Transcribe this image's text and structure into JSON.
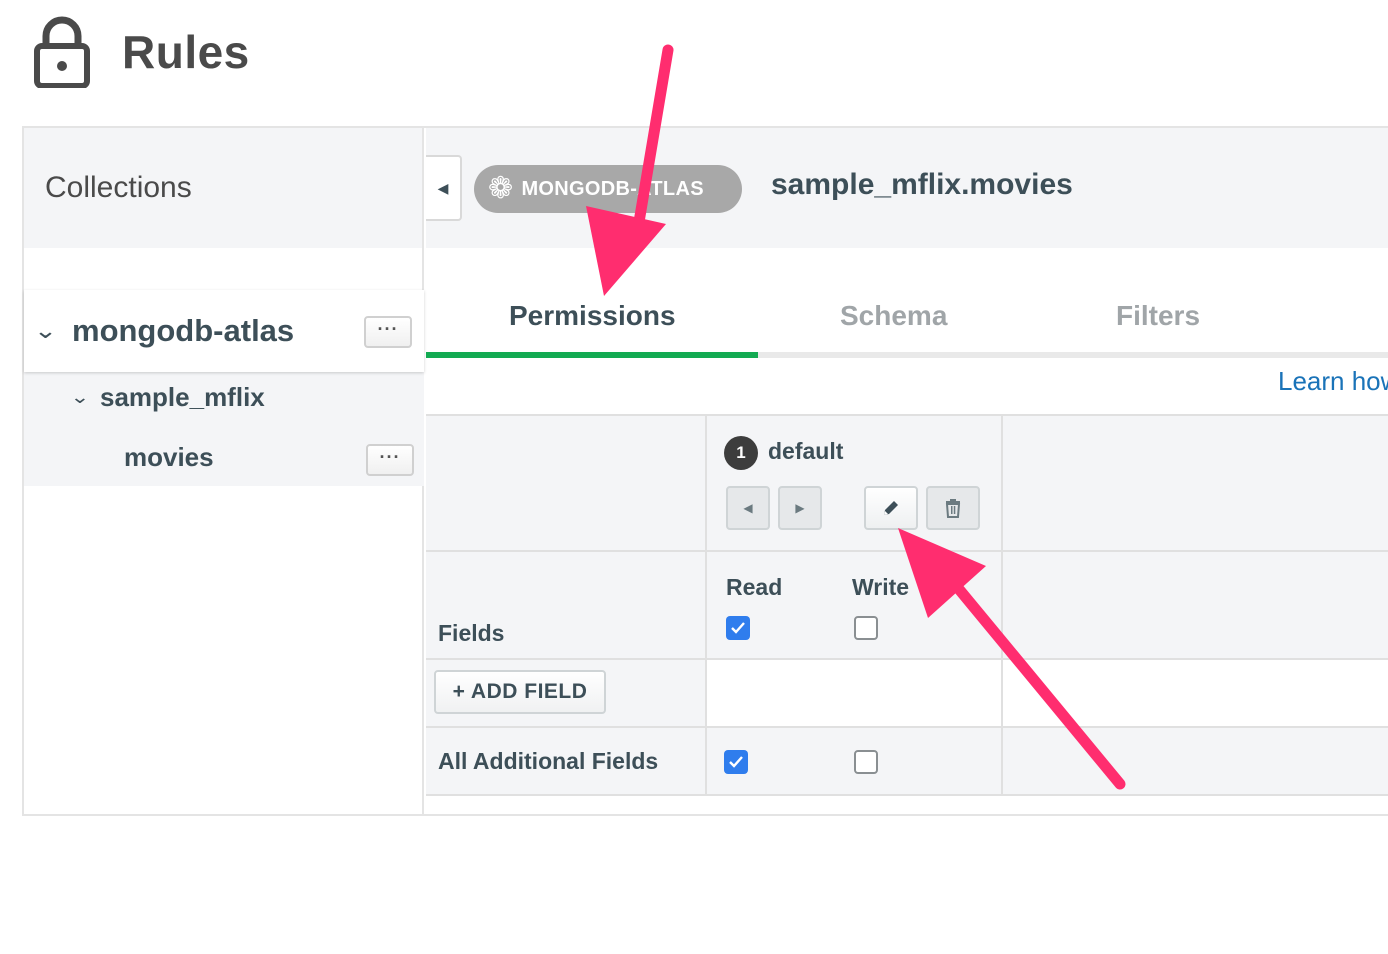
{
  "page": {
    "title": "Rules",
    "icon": "lock-icon"
  },
  "sidebar": {
    "heading": "Collections",
    "database": {
      "label": "mongodb-atlas",
      "menu_label": "···"
    },
    "collection_group": {
      "label": "sample_mflix"
    },
    "collection": {
      "label": "movies",
      "menu_label": "···"
    }
  },
  "main": {
    "service_badge": "MONGODB-ATLAS",
    "namespace": "sample_mflix.movies",
    "tabs": [
      {
        "label": "Permissions",
        "active": true
      },
      {
        "label": "Schema",
        "active": false
      },
      {
        "label": "Filters",
        "active": false
      }
    ],
    "learn_link": "Learn how"
  },
  "roles": {
    "index": "1",
    "name": "default"
  },
  "permissions": {
    "read_label": "Read",
    "write_label": "Write",
    "fields_label": "Fields",
    "fields_read": true,
    "fields_write": false,
    "add_field_label": "+ ADD FIELD",
    "additional_label": "All Additional Fields",
    "additional_read": true,
    "additional_write": false
  },
  "colors": {
    "accent_tab": "#13aa52",
    "checkbox_on": "#2f7ded",
    "link": "#1a73b8",
    "annotation_arrow": "#ff2d6f"
  }
}
